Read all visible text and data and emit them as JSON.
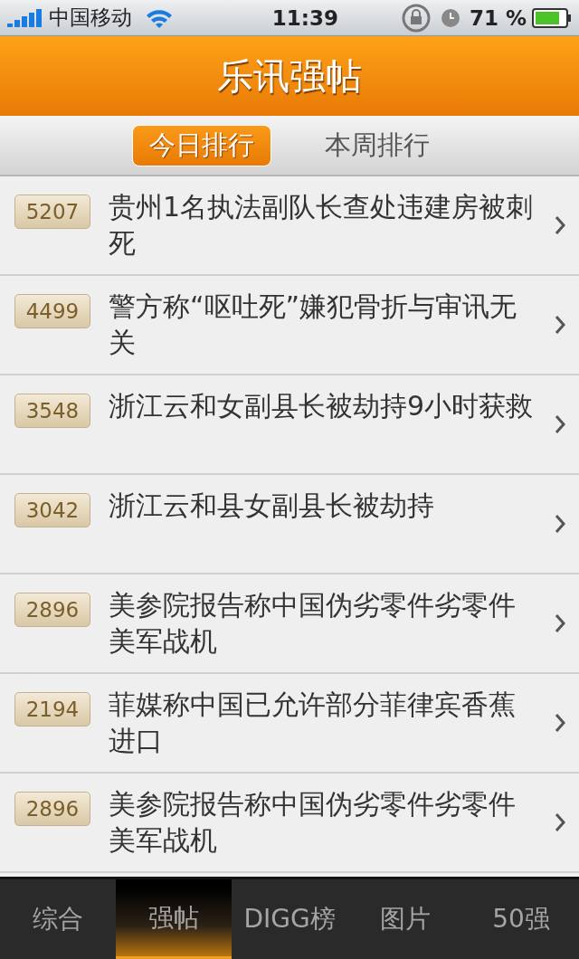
{
  "status_bar": {
    "carrier": "中国移动",
    "time": "11:39",
    "battery": "71 %"
  },
  "header": {
    "title": "乐讯强帖"
  },
  "tabs": [
    {
      "label": "今日排行",
      "selected": true
    },
    {
      "label": "本周排行",
      "selected": false
    }
  ],
  "rows": [
    {
      "count": "5207",
      "title": "贵州1名执法副队长查处违建房被刺死"
    },
    {
      "count": "4499",
      "title": "警方称“呕吐死”嫌犯骨折与审讯无关"
    },
    {
      "count": "3548",
      "title": "浙江云和女副县长被劫持9小时获救"
    },
    {
      "count": "3042",
      "title": "浙江云和县女副县长被劫持"
    },
    {
      "count": "2896",
      "title": "美参院报告称中国伪劣零件劣零件美军战机"
    },
    {
      "count": "2194",
      "title": "菲媒称中国已允许部分菲律宾香蕉进口"
    },
    {
      "count": "2896",
      "title": "美参院报告称中国伪劣零件劣零件美军战机"
    }
  ],
  "tab_bar": [
    {
      "label": "综合",
      "selected": false
    },
    {
      "label": "强帖",
      "selected": true
    },
    {
      "label": "DIGG榜",
      "selected": false
    },
    {
      "label": "图片",
      "selected": false
    },
    {
      "label": "50强",
      "selected": false
    }
  ]
}
